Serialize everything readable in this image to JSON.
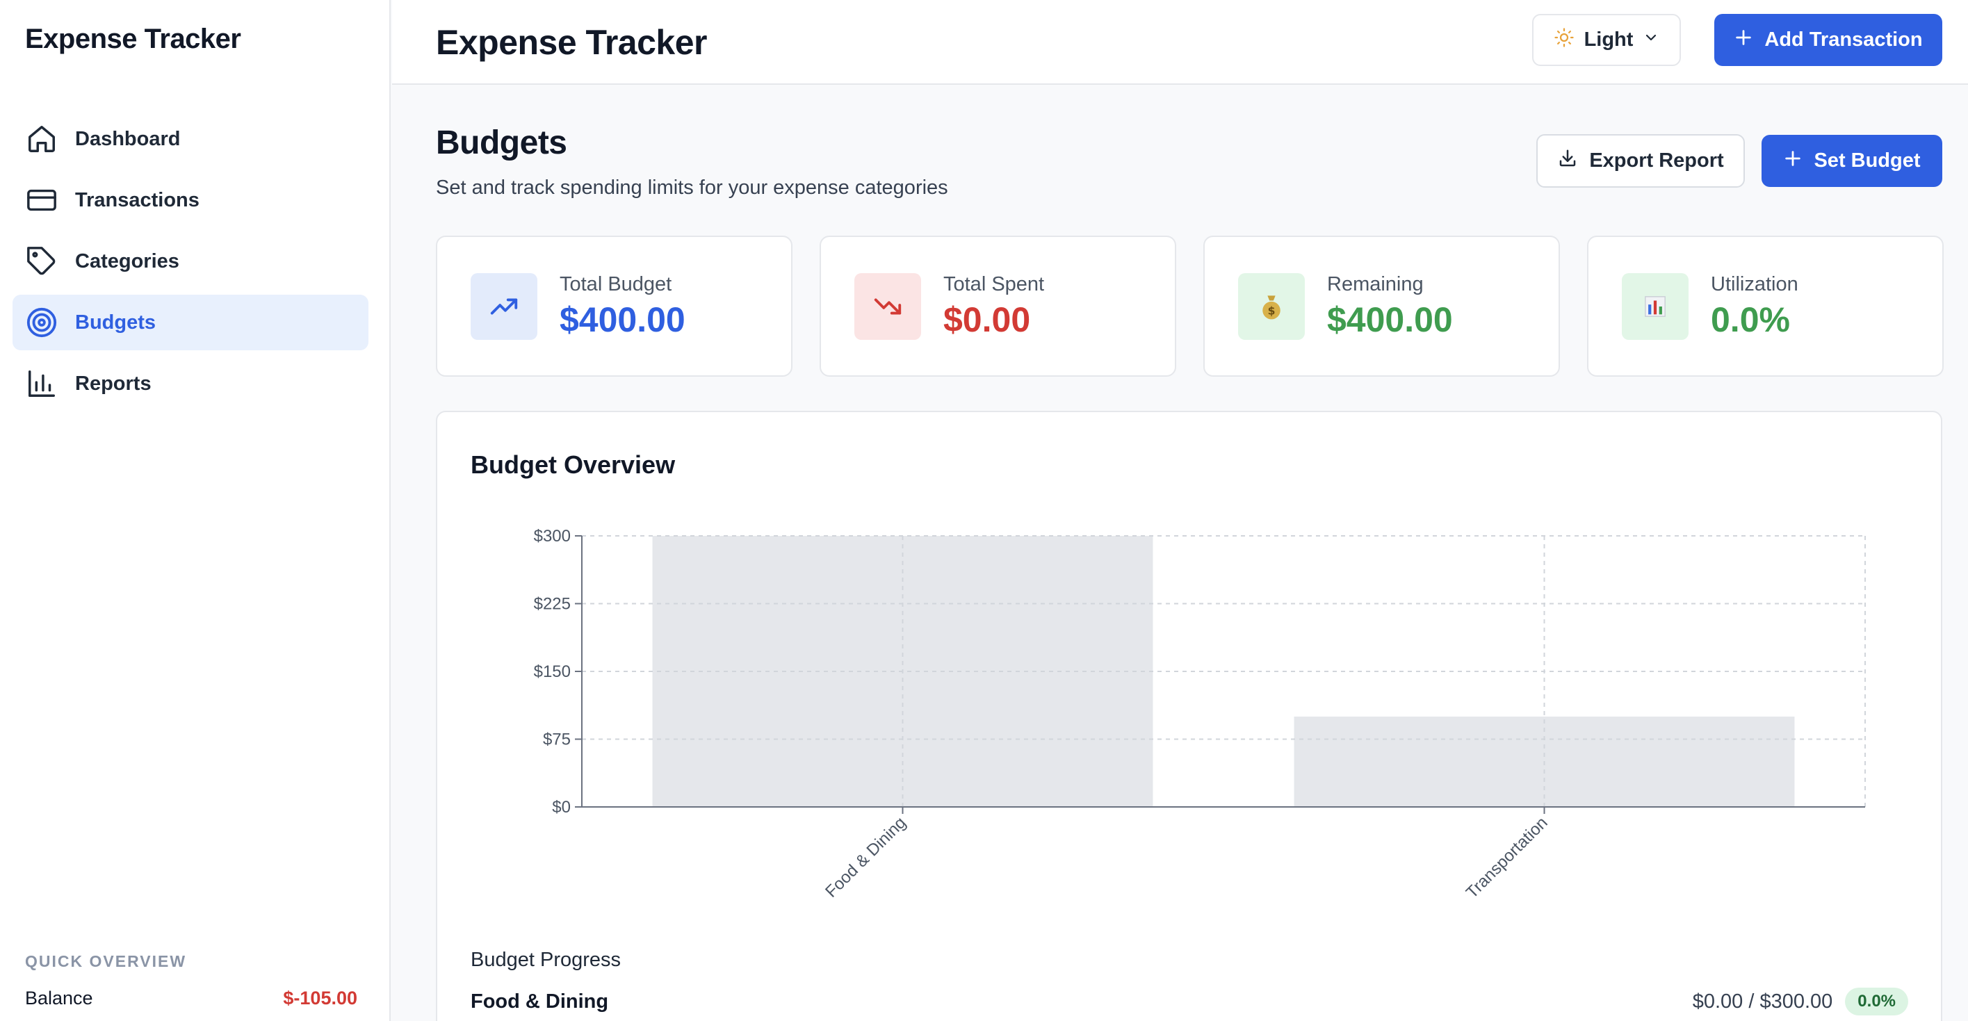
{
  "app": {
    "title": "Expense Tracker"
  },
  "sidebar": {
    "items": [
      {
        "label": "Dashboard",
        "icon": "home-icon"
      },
      {
        "label": "Transactions",
        "icon": "credit-card-icon"
      },
      {
        "label": "Categories",
        "icon": "tag-icon"
      },
      {
        "label": "Budgets",
        "icon": "target-icon",
        "active": true
      },
      {
        "label": "Reports",
        "icon": "bar-chart-icon"
      }
    ],
    "quick_overview": {
      "title": "QUICK OVERVIEW",
      "balance_label": "Balance",
      "balance_value": "$-105.00"
    }
  },
  "header": {
    "title": "Expense Tracker",
    "theme_label": "Light",
    "add_label": "Add Transaction"
  },
  "page": {
    "title": "Budgets",
    "subtitle": "Set and track spending limits for your expense categories",
    "export_label": "Export Report",
    "set_budget_label": "Set Budget"
  },
  "stats": [
    {
      "label": "Total Budget",
      "value": "$400.00",
      "color": "#2f5fe0",
      "icon": "trending-up-icon"
    },
    {
      "label": "Total Spent",
      "value": "$0.00",
      "color": "#d23a34",
      "icon": "trending-down-icon"
    },
    {
      "label": "Remaining",
      "value": "$400.00",
      "color": "#3f9c4f",
      "icon": "money-bag-icon"
    },
    {
      "label": "Utilization",
      "value": "0.0%",
      "color": "#3f9c4f",
      "icon": "bar-chart-emoji-icon"
    }
  ],
  "overview": {
    "title": "Budget Overview",
    "progress_title": "Budget Progress",
    "progress": [
      {
        "name": "Food & Dining",
        "amount": "$0.00 / $300.00",
        "pct": "0.0%"
      }
    ]
  },
  "chart_data": {
    "type": "bar",
    "categories": [
      "Food & Dining",
      "Transportation"
    ],
    "series": [
      {
        "values": [
          300,
          100
        ],
        "color": "#e5e7eb"
      }
    ],
    "ylim": [
      0,
      300
    ],
    "yticks": [
      "$0",
      "$75",
      "$150",
      "$225",
      "$300"
    ],
    "ytick_values": [
      0,
      75,
      150,
      225,
      300
    ],
    "grid": true
  }
}
